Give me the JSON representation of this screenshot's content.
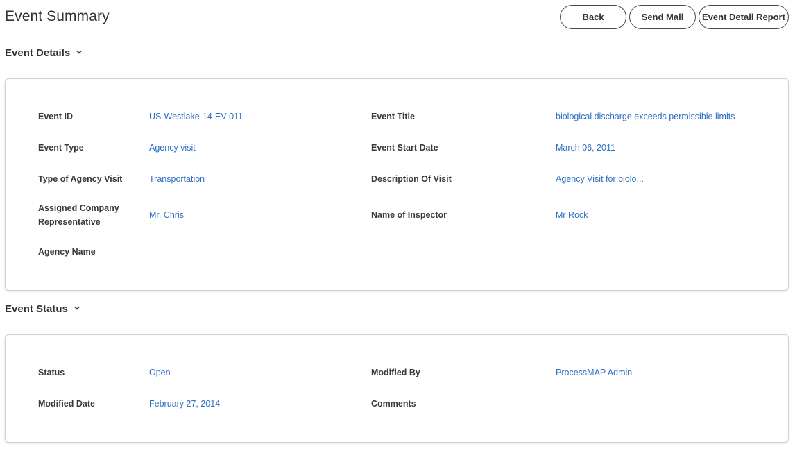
{
  "header": {
    "title": "Event Summary",
    "buttons": {
      "back": "Back",
      "send_mail": "Send Mail",
      "report": "Event Detail Report"
    }
  },
  "event_details": {
    "heading": "Event Details",
    "chevron_icon": "chevron-down-icon",
    "fields": {
      "event_id": {
        "label": "Event ID",
        "value": "US-Westlake-14-EV-011"
      },
      "event_title": {
        "label": "Event Title",
        "value": "biological discharge exceeds permissible limits"
      },
      "event_type": {
        "label": "Event Type",
        "value": "Agency visit"
      },
      "event_start_date": {
        "label": "Event Start Date",
        "value": "March 06, 2011"
      },
      "agency_visit_type": {
        "label": "Type of Agency Visit",
        "value": "Transportation"
      },
      "visit_description": {
        "label": "Description Of Visit",
        "value": "Agency Visit for biolo..."
      },
      "company_rep": {
        "label_line1": "Assigned Company",
        "label_line2": "Representative",
        "value": "Mr. Chris"
      },
      "inspector": {
        "label": "Name of Inspector",
        "value": "Mr Rock"
      },
      "agency_name": {
        "label": "Agency Name",
        "value": ""
      }
    }
  },
  "event_status": {
    "heading": "Event Status",
    "chevron_icon": "chevron-down-icon",
    "fields": {
      "status": {
        "label": "Status",
        "value": "Open"
      },
      "modified_by": {
        "label": "Modified By",
        "value": "ProcessMAP Admin"
      },
      "modified_date": {
        "label": "Modified Date",
        "value": "February 27, 2014"
      },
      "comments": {
        "label": "Comments",
        "value": ""
      }
    }
  },
  "colors": {
    "value_link": "#2e6fc4",
    "label_text": "#3a3a3a",
    "border": "#d0d0d0"
  }
}
